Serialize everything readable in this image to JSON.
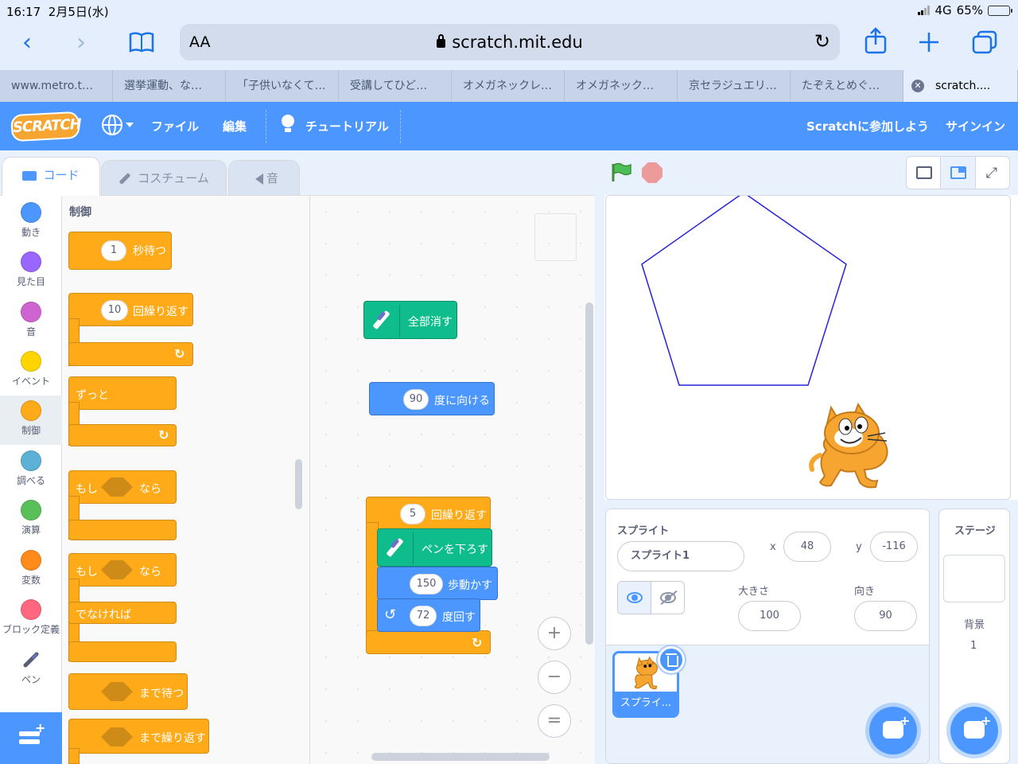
{
  "status_bar": {
    "time": "16:17",
    "date": "2月5日(水)",
    "network": "4G",
    "battery": "65%"
  },
  "browser": {
    "text_size_label": "AA",
    "url": "scratch.mit.edu",
    "tabs": [
      "www.metro.t…",
      "選挙運動、な…",
      "「子供いなくて…",
      "受講してひど…",
      "オメガネックレ…",
      "オメガネック…",
      "京セラジュエリ…",
      "たぞえとめぐ…",
      "scratch...."
    ]
  },
  "menubar": {
    "logo": "SCRATCH",
    "file": "ファイル",
    "edit": "編集",
    "tutorials": "チュートリアル",
    "join": "Scratchに参加しよう",
    "signin": "サインイン"
  },
  "editor_tabs": {
    "code": "コード",
    "costumes": "コスチューム",
    "sounds": "音"
  },
  "categories": [
    {
      "label": "動き",
      "color": "#4c97ff"
    },
    {
      "label": "見た目",
      "color": "#9966ff"
    },
    {
      "label": "音",
      "color": "#cf63cf"
    },
    {
      "label": "イベント",
      "color": "#ffd500"
    },
    {
      "label": "制御",
      "color": "#ffab19"
    },
    {
      "label": "調べる",
      "color": "#5cb1d6"
    },
    {
      "label": "演算",
      "color": "#59c059"
    },
    {
      "label": "変数",
      "color": "#ff8c1a"
    },
    {
      "label": "ブロック定義",
      "color": "#ff6680"
    },
    {
      "label": "ペン",
      "color": "#0fbd8c"
    }
  ],
  "palette": {
    "title": "制御",
    "wait": {
      "value": "1",
      "label": "秒待つ"
    },
    "repeat": {
      "value": "10",
      "label": "回繰り返す"
    },
    "forever": "ずっと",
    "if_then": {
      "if": "もし",
      "then": "なら"
    },
    "if_else": {
      "if": "もし",
      "then": "なら",
      "else": "でなければ"
    },
    "wait_until": "まで待つ",
    "repeat_until": "まで繰り返す"
  },
  "script": {
    "clear": "全部消す",
    "point_dir": {
      "value": "90",
      "label": "度に向ける"
    },
    "repeat": {
      "value": "5",
      "label": "回繰り返す"
    },
    "pen_down": "ペンを下ろす",
    "move": {
      "value": "150",
      "label": "歩動かす"
    },
    "turn": {
      "value": "72",
      "label": "度回す"
    }
  },
  "zoom": {
    "zoom_in": "+",
    "zoom_out": "−",
    "reset": "="
  },
  "sprite_info": {
    "title": "スプライト",
    "name": "スプライト1",
    "x_label": "x",
    "x": "48",
    "y_label": "y",
    "y": "-116",
    "size_label": "大きさ",
    "size": "100",
    "direction_label": "向き",
    "direction": "90",
    "thumb_name": "スプライ..."
  },
  "stage_panel": {
    "title": "ステージ",
    "backdrops_label": "背景",
    "backdrops_count": "1"
  },
  "colors": {
    "scratch_blue": "#4c97ff",
    "control": "#ffab19",
    "pen": "#0fbd8c",
    "pentagon_stroke": "#2424d8"
  }
}
